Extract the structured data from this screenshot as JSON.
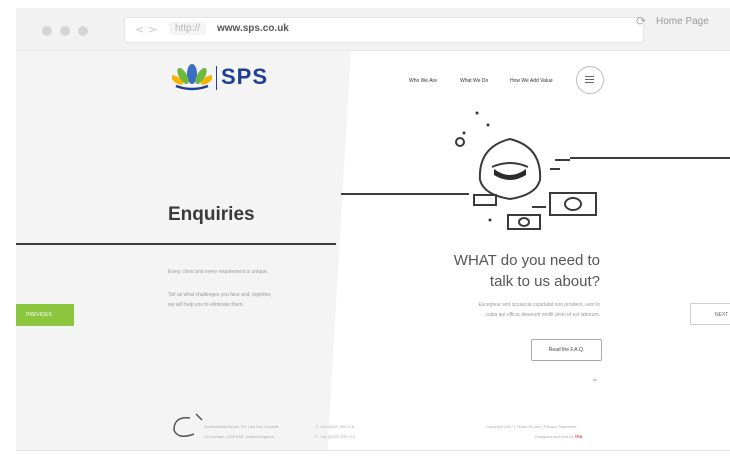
{
  "browser": {
    "nav_arrows": "< >",
    "url_scheme": "http://",
    "url_domain": "www.sps.co.uk",
    "reload_icon": "reload-icon",
    "home_label": "Home Page"
  },
  "brand": {
    "name": "SPS",
    "color": "#1e3f95",
    "accent": "#8cc63f"
  },
  "nav": {
    "who": "Who We Are",
    "what": "What We Do",
    "how": "How We Add Value"
  },
  "left": {
    "title": "Enquiries",
    "line1": "Every client and every requirement is unique.",
    "line2": "Tell us what challenges you face and, together,",
    "line3": "we will help you to eliminate them.",
    "prev_label": "PREVIOUS"
  },
  "right": {
    "heading1": "WHAT do you need to",
    "heading2": "talk to us about?",
    "lorem1": "Excepteur sint occaecat cupidatat non proident, sunt in",
    "lorem2": "culpa qui officia deserunt mollit anim id est laborum.",
    "faq_label": "Read the F.A.Q.",
    "next_label": "NEXT"
  },
  "footer": {
    "address1": "Northumbria House, Pic | Ind Est, Consett,",
    "address2": "Co Durham, DH8 6TB, United Kingdom",
    "phone": "T: +44 (0)207 000 176",
    "fax": "F: +44 (0)207 000 174",
    "legal": "Copyright 2017 | Terms Of Use | Privacy Statement",
    "designed": "Designed and built by",
    "designer": "TPA"
  }
}
